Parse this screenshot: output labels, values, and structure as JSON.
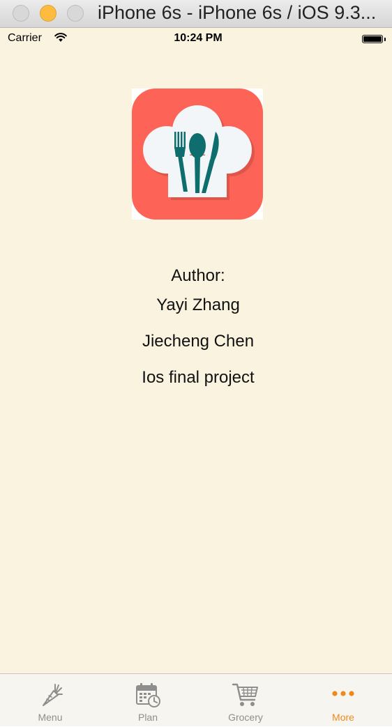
{
  "window": {
    "title": "iPhone 6s - iPhone 6s / iOS 9.3..."
  },
  "status_bar": {
    "carrier": "Carrier",
    "time": "10:24 PM",
    "wifi_icon": "wifi-icon",
    "battery_icon": "battery-icon",
    "battery_level": 1.0
  },
  "content": {
    "logo_icon": "chef-hat-cutlery-icon",
    "author_label": "Author:",
    "authors": [
      "Yayi Zhang",
      "Jiecheng Chen"
    ],
    "project": "Ios final project"
  },
  "tab_bar": {
    "tabs": [
      {
        "label": "Menu",
        "icon": "carrot-icon",
        "active": false
      },
      {
        "label": "Plan",
        "icon": "calendar-clock-icon",
        "active": false
      },
      {
        "label": "Grocery",
        "icon": "shopping-cart-icon",
        "active": false
      },
      {
        "label": "More",
        "icon": "more-dots-icon",
        "active": true
      }
    ]
  },
  "colors": {
    "background": "#faf3df",
    "logo_red": "#fd6356",
    "cutlery_teal": "#0e6e6d",
    "active_tab": "#f0891b",
    "inactive_tab": "#8e8e8e"
  }
}
